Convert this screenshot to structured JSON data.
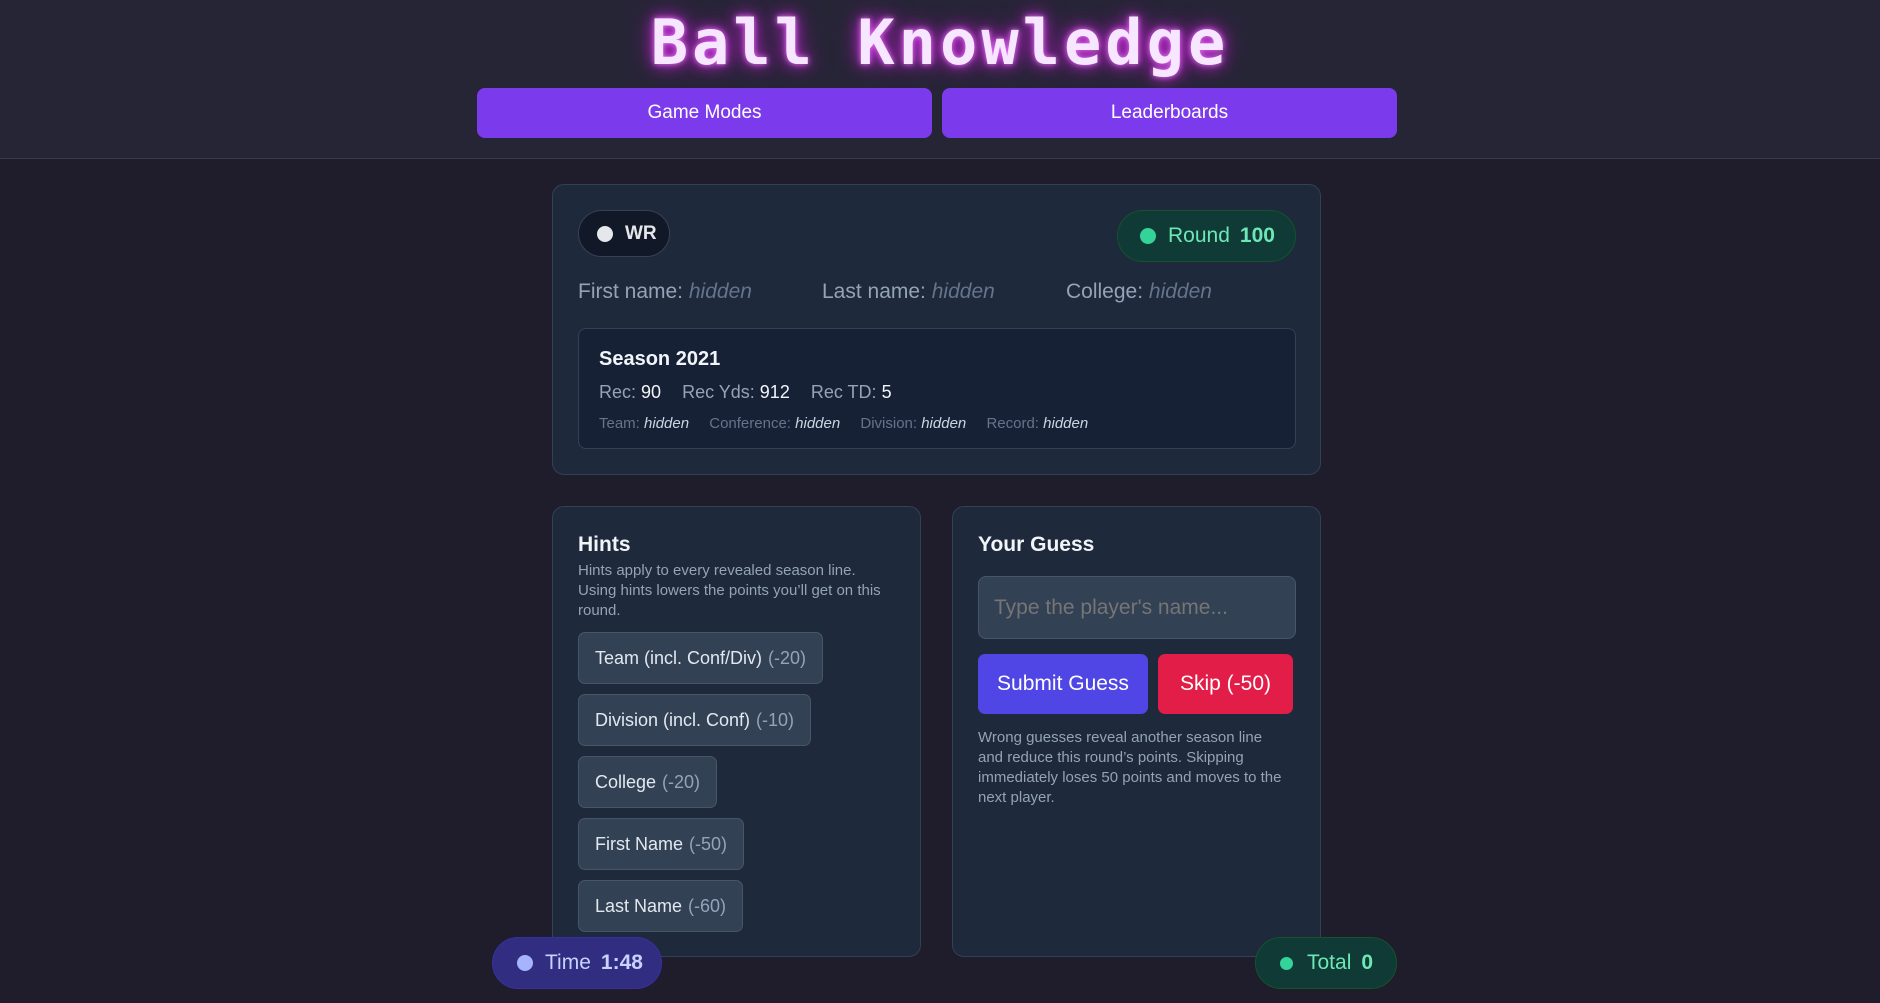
{
  "header": {
    "logo": "Ball Knowledge",
    "nav": [
      {
        "label": "Game Modes"
      },
      {
        "label": "Leaderboards"
      }
    ]
  },
  "player_card": {
    "position": "WR",
    "round_label": "Round",
    "round_value": "100",
    "fields": [
      {
        "label": "First name:",
        "value": "hidden"
      },
      {
        "label": "Last name:",
        "value": "hidden"
      },
      {
        "label": "College:",
        "value": "hidden"
      }
    ],
    "season": {
      "title": "Season 2021",
      "stats": [
        {
          "label": "Rec:",
          "value": "90"
        },
        {
          "label": "Rec Yds:",
          "value": "912"
        },
        {
          "label": "Rec TD:",
          "value": "5"
        }
      ],
      "meta": [
        {
          "label": "Team:",
          "value": "hidden"
        },
        {
          "label": "Conference:",
          "value": "hidden"
        },
        {
          "label": "Division:",
          "value": "hidden"
        },
        {
          "label": "Record:",
          "value": "hidden"
        }
      ]
    }
  },
  "hints": {
    "title": "Hints",
    "description": "Hints apply to every revealed season line. Using hints lowers the points you’ll get on this round.",
    "items": [
      {
        "label": "Team (incl. Conf/Div)",
        "cost": "(-20)"
      },
      {
        "label": "Division (incl. Conf)",
        "cost": "(-10)"
      },
      {
        "label": "College",
        "cost": "(-20)"
      },
      {
        "label": "First Name",
        "cost": "(-50)"
      },
      {
        "label": "Last Name",
        "cost": "(-60)"
      }
    ]
  },
  "guess": {
    "title": "Your Guess",
    "placeholder": "Type the player's name...",
    "submit_label": "Submit Guess",
    "skip_label": "Skip (-50)",
    "note": "Wrong guesses reveal another season line and reduce this round’s points. Skipping immediately loses 50 points and moves to the next player."
  },
  "timer": {
    "label": "Time",
    "value": "1:48"
  },
  "total": {
    "label": "Total",
    "value": "0"
  },
  "colors": {
    "accent": "#7c3aed",
    "submit": "#4f46e5",
    "skip": "#e11d48",
    "success": "#34d399",
    "timer": "#a5b4fc"
  }
}
